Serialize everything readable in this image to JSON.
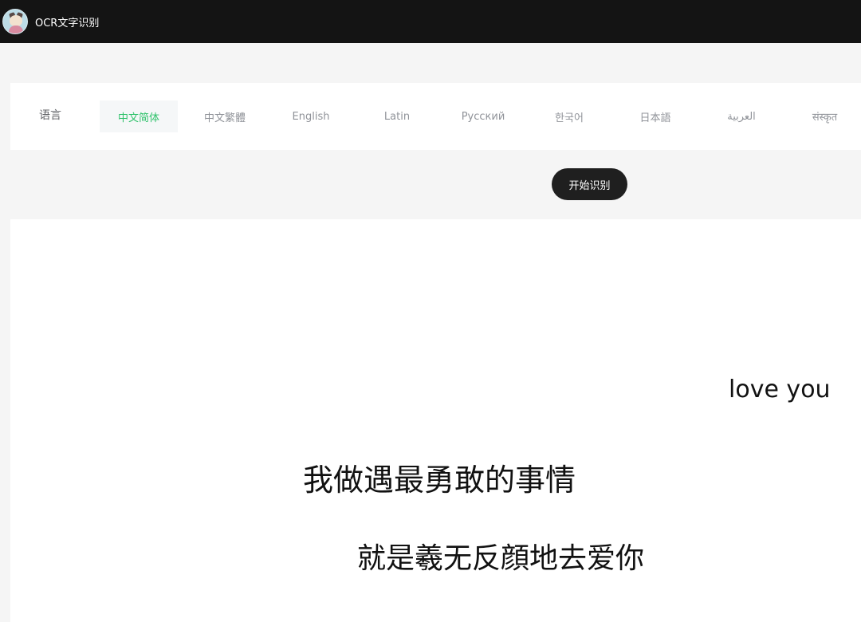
{
  "header": {
    "title": "OCR文字识别",
    "avatar_icon": "cartoon-avatar-icon"
  },
  "languages": {
    "label": "语言",
    "active": "中文简体",
    "tabs": [
      {
        "label": "中文简体"
      },
      {
        "label": "中文繁體"
      },
      {
        "label": "English"
      },
      {
        "label": "Latin"
      },
      {
        "label": "Русский"
      },
      {
        "label": "한국어"
      },
      {
        "label": "日本語"
      },
      {
        "label": "العربية"
      },
      {
        "label": "संस्कृत"
      }
    ]
  },
  "actions": {
    "start_label": "开始识别"
  },
  "image": {
    "lines": [
      "love you",
      "我做遇最勇敢的事情",
      "就是羲无反顔地去爱你"
    ]
  },
  "colors": {
    "topbar": "#141414",
    "accent_active": "#2ec26a",
    "button_bg": "#1f1f1f"
  }
}
